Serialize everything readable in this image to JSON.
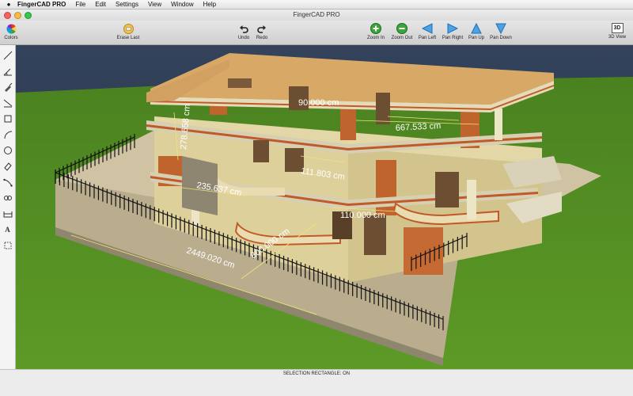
{
  "menubar": {
    "app_name": "FingerCAD PRO",
    "items": [
      "File",
      "Edit",
      "Settings",
      "View",
      "Window",
      "Help"
    ]
  },
  "window": {
    "title": "FingerCAD PRO"
  },
  "toolbar": {
    "colors": "Colors",
    "erase_last": "Erase Last",
    "undo": "Undo",
    "redo": "Redo",
    "zoom_in": "Zoom In",
    "zoom_out": "Zoom Out",
    "pan_left": "Pan Left",
    "pan_right": "Pan Right",
    "pan_up": "Pan Up",
    "pan_down": "Pan Down",
    "view_3d": "3D View",
    "view_3d_icon_text": "3D"
  },
  "dimensions": {
    "d1": "90.000 cm",
    "d2": "667.533 cm",
    "d3": "278.658 cm",
    "d4": "111.803 cm",
    "d5": "235.637 cm",
    "d6": "110.000 cm",
    "d7": "800.000 cm",
    "d8": "2449.020 cm"
  },
  "tools": {
    "text_tool": "A"
  },
  "status": {
    "text": "SELECTION RECTANGLE: ON"
  },
  "colors": {
    "sky": "#2c3b52",
    "grass": "#4f8a1e",
    "wall": "#e2d6a4",
    "brick": "#c0642d",
    "zoom_green": "#3aa63a",
    "pan_blue": "#4aa3e8"
  }
}
